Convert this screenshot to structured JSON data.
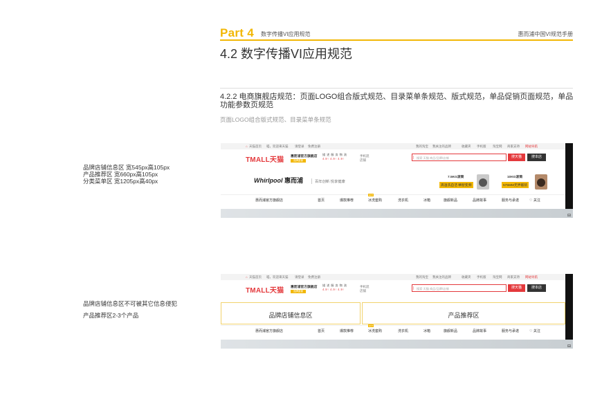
{
  "header": {
    "part_label": "Part 4",
    "part_subtitle": "数字传播VI应用规范",
    "manual_title": "惠而浦中国VI规范手册",
    "section_title": "4.2 数字传播VI应用规范"
  },
  "subsection": {
    "heading": "4.2.2 电商旗舰店规范：页面LOGO组合版式规范、目录菜单条规范、版式规范，单品促销页面规范，单品功能参数页规范",
    "caption": "页面LOGO组合版式规范、目录菜单条规范"
  },
  "notes": {
    "block1": [
      "品牌店铺信息区  宽545px高105px",
      "产品推荐区  宽660px高105px",
      "分类菜单区  宽1205px高40px"
    ],
    "block2_line1": "品牌店铺信息区不可被其它信息侵犯",
    "block2_line2": "产品推荐区2-3个产品"
  },
  "store": {
    "topbar_left": [
      "天猫首页",
      "喵，欢迎来天猫",
      "请登录",
      "免费注册"
    ],
    "topbar_right": [
      "我的淘宝",
      "我关注的品牌",
      "收藏夹",
      "手机版",
      "淘宝网",
      "商家支持",
      "网站导航"
    ],
    "logo_text": "TMALL天猫",
    "shop_name": "惠而浦官方旗舰店",
    "shop_badge": "品牌直营",
    "ratings_top": "描 述  服 务  物 流",
    "ratings_bottom": "4.9↑ 4.9↑ 4.9↑",
    "phone_label": "手机逛",
    "phone_sub": "店铺",
    "search_placeholder": "搜索 天猫 商品/品牌/店铺",
    "search_button": "搜天猫",
    "search_shop_button": "搜本店",
    "brand_logo": "Whirlpool",
    "brand_logo_cn": "惠而浦",
    "slogan": "百年创新 悦享健康",
    "product1_title": "7.5KG滚筒",
    "product1_badge": "高温洗自洁 精智变频",
    "product2_title": "10KG滚筒",
    "product2_badge": "575MM无界嵌装",
    "nav": {
      "shop_name": "惠而浦官方旗舰店",
      "items": [
        "首页",
        "爆款推荐",
        "冰洗套购",
        "洗衣机",
        "冰箱",
        "旗舰新品",
        "品牌故事",
        "服务与承诺"
      ],
      "follow": "♡ 关注",
      "hot_tag": "HOT"
    },
    "zone_brand": "品牌店铺信息区",
    "zone_product": "产品推荐区"
  },
  "colors": {
    "accent": "#f2b705",
    "tmall_red": "#e4393c"
  }
}
